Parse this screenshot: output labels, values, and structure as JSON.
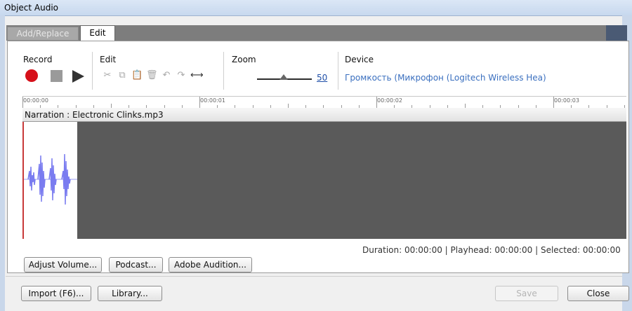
{
  "window": {
    "title": "Object Audio"
  },
  "tabs": [
    {
      "label": "Add/Replace"
    },
    {
      "label": "Edit"
    }
  ],
  "toolbar": {
    "record_label": "Record",
    "edit_label": "Edit",
    "zoom_label": "Zoom",
    "zoom_value": "50",
    "zoom_level": 0.5,
    "device_label": "Device",
    "device_value": "Громкость (Микрофон (Logitech Wireless Hea)"
  },
  "ruler": {
    "ticks": [
      "00:00:00",
      "00:00:01",
      "00:00:02",
      "00:00:03"
    ]
  },
  "track": {
    "name": "Narration : Electronic Clinks.mp3"
  },
  "status": {
    "text": "Duration:  00:00:00 | Playhead:  00:00:00 | Selected:  00:00:00"
  },
  "buttons": {
    "adjust_volume": "Adjust Volume...",
    "podcast": "Podcast...",
    "adobe_audition": "Adobe Audition...",
    "import": "Import (F6)...",
    "library": "Library...",
    "save": "Save",
    "close": "Close"
  },
  "icons": {
    "record": "record-icon",
    "stop": "stop-icon",
    "play": "play-icon",
    "cut": "scissors-icon",
    "copy": "copy-icon",
    "paste": "paste-icon",
    "delete": "trash-icon",
    "undo": "undo-icon",
    "redo": "redo-icon",
    "fit": "fit-width-icon"
  },
  "colors": {
    "record": "#d6101a",
    "waveform": "#7a7cf0",
    "link": "#1f4fa8"
  }
}
